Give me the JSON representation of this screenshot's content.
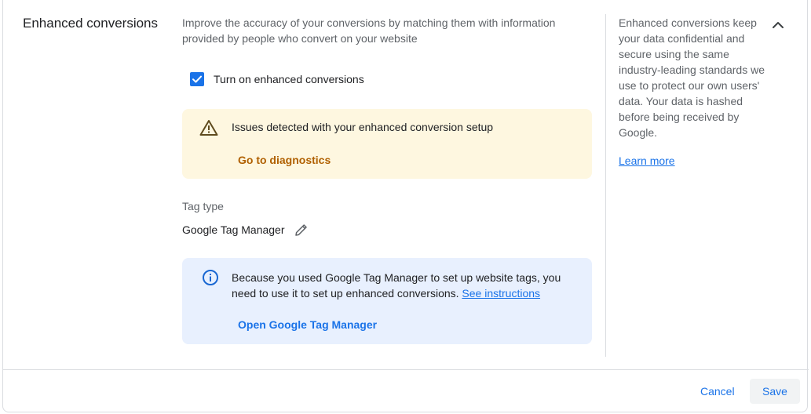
{
  "section": {
    "title": "Enhanced conversions",
    "description": "Improve the accuracy of your conversions by matching them with information provided by people who convert on your website"
  },
  "checkbox": {
    "label": "Turn on enhanced conversions",
    "checked": true
  },
  "warning": {
    "message": "Issues detected with your enhanced conversion setup",
    "action": "Go to diagnostics",
    "icon": "warning-triangle-icon"
  },
  "tag_type": {
    "label": "Tag type",
    "value": "Google Tag Manager"
  },
  "info": {
    "message": "Because you used Google Tag Manager to set up website tags, you need to use it to set up enhanced conversions.",
    "inline_link": "See instructions",
    "action": "Open Google Tag Manager",
    "icon": "info-icon"
  },
  "side": {
    "text": "Enhanced conversions keep your data confidential and secure using the same industry-leading standards we use to protect our own users' data. Your data is hashed before being received by Google.",
    "link": "Learn more"
  },
  "footer": {
    "cancel": "Cancel",
    "save": "Save"
  },
  "colors": {
    "accent": "#1a73e8",
    "warning_bg": "#fef7e0",
    "warning_link": "#b06000",
    "info_bg": "#e8f0fe"
  }
}
